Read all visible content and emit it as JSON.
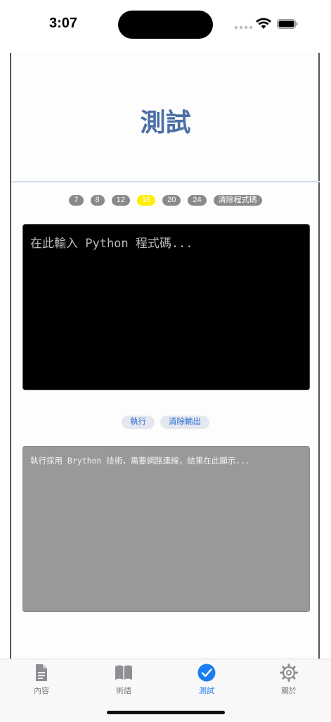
{
  "status_bar": {
    "time": "3:07"
  },
  "page": {
    "title": "測試"
  },
  "font_sizes": {
    "options": [
      "7",
      "8",
      "12",
      "16",
      "20",
      "24"
    ],
    "selected": "16",
    "clear_code_label": "清除程式碼"
  },
  "editor": {
    "placeholder": "在此輸入 Python 程式碼..."
  },
  "actions": {
    "run_label": "執行",
    "clear_output_label": "清除輸出"
  },
  "output": {
    "placeholder": "執行採用 Brython 技術，需要網路連線，結果在此顯示..."
  },
  "tabbar": {
    "tabs": [
      {
        "label": "內容",
        "icon": "document-icon",
        "active": false
      },
      {
        "label": "術語",
        "icon": "book-icon",
        "active": false
      },
      {
        "label": "測試",
        "icon": "checkmark-circle-icon",
        "active": true
      },
      {
        "label": "關於",
        "icon": "gear-icon",
        "active": false
      }
    ]
  },
  "colors": {
    "title": "#4a6ea6",
    "chip": "#8a8a8a",
    "chip_active": "#ffee00",
    "accent": "#1a7df0",
    "editor_bg": "#000000",
    "output_bg": "#999999"
  }
}
